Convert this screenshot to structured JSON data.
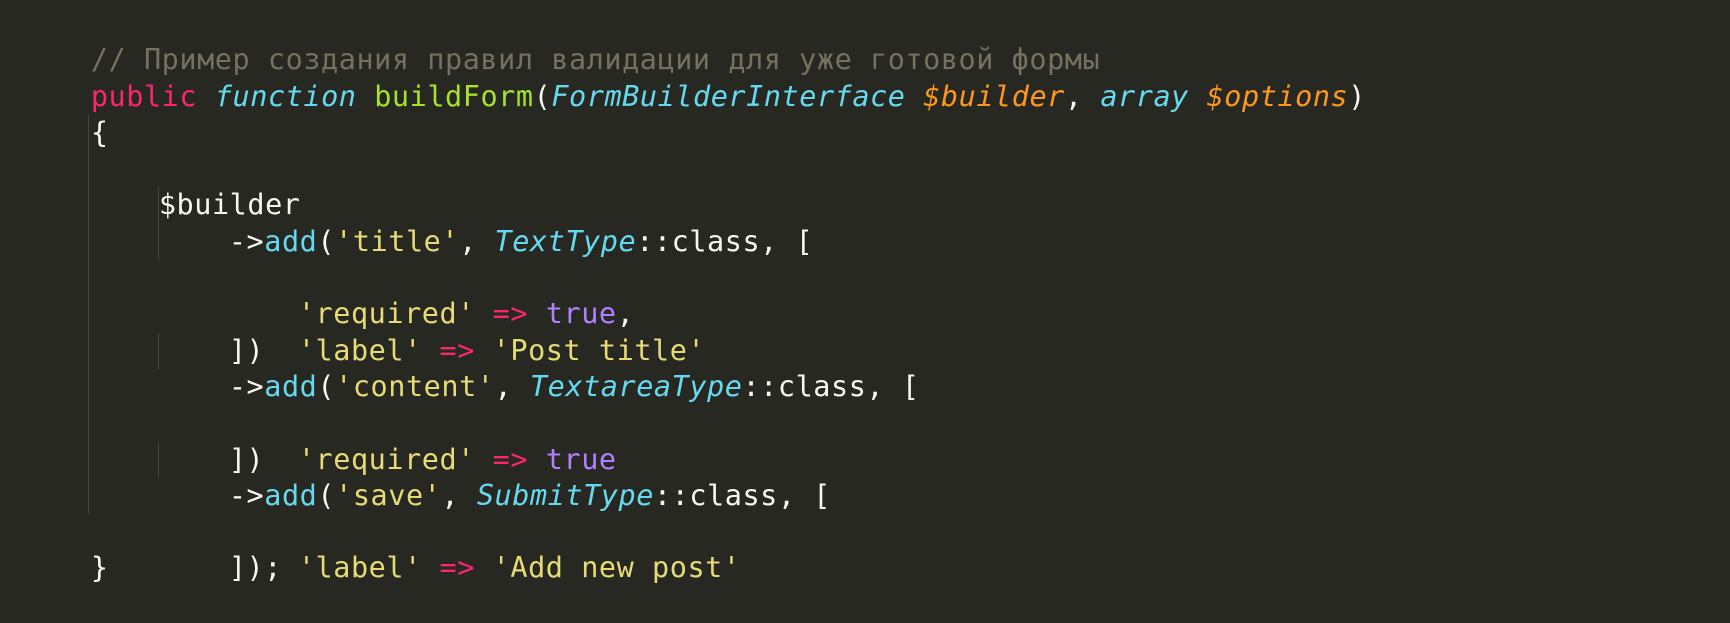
{
  "code": {
    "comment": "// Пример создания правил валидации для уже готовой формы",
    "l2": {
      "public": "public",
      "function": "function",
      "sp": " ",
      "name": "buildForm",
      "paren_open": "(",
      "type1": "FormBuilderInterface",
      "var1": "$builder",
      "comma": ", ",
      "type2": "array",
      "var2": "$options",
      "paren_close": ")"
    },
    "brace_open": "{",
    "builder_var": "$builder",
    "arrow": "->",
    "add": "add",
    "lparen": "(",
    "rparen_comma": ", ",
    "scope": "::",
    "class_kw": "class",
    "open_arr": ", [",
    "fat_arrow": "=>",
    "sp": " ",
    "comma": ",",
    "close1": "])",
    "close_last": "]);",
    "t1": {
      "field": "'title'",
      "type": "TextType",
      "key1": "'required'",
      "val1": "true",
      "key2": "'label'",
      "val2": "'Post title'"
    },
    "t2": {
      "field": "'content'",
      "type": "TextareaType",
      "key1": "'required'",
      "val1": "true"
    },
    "t3": {
      "field": "'save'",
      "type": "SubmitType",
      "key1": "'label'",
      "val1": "'Add new post'"
    },
    "brace_close": "}"
  },
  "colors": {
    "background": "#272822",
    "comment": "#75715e",
    "keyword": "#f92672",
    "storage": "#66d9ef",
    "function": "#a6e22e",
    "variable": "#fd971f",
    "string": "#e6db74",
    "constant": "#ae81ff",
    "text": "#f8f8f2"
  }
}
